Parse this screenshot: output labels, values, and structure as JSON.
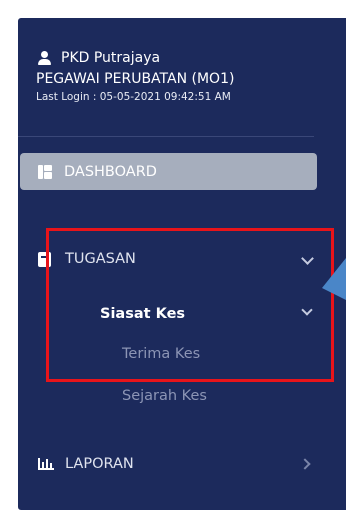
{
  "user": {
    "name": "PKD Putrajaya",
    "role": "PEGAWAI PERUBATAN (MO1)",
    "last_login": "Last Login : 05-05-2021 09:42:51 AM"
  },
  "nav": {
    "dashboard": "DASHBOARD",
    "tugasan": "TUGASAN",
    "siasat_kes": "Siasat Kes",
    "terima_kes": "Terima Kes",
    "sejarah_kes": "Sejarah Kes",
    "laporan": "LAPORAN"
  },
  "colors": {
    "sidebar_bg": "#1c2a5c",
    "active_item_bg": "#a6aebd",
    "annotation_red": "#e8141a",
    "callout_blue": "#4a86c8"
  },
  "icons": {
    "user": "user-icon",
    "dashboard": "dashboard-icon",
    "tugasan": "book-icon",
    "laporan": "chart-icon"
  }
}
